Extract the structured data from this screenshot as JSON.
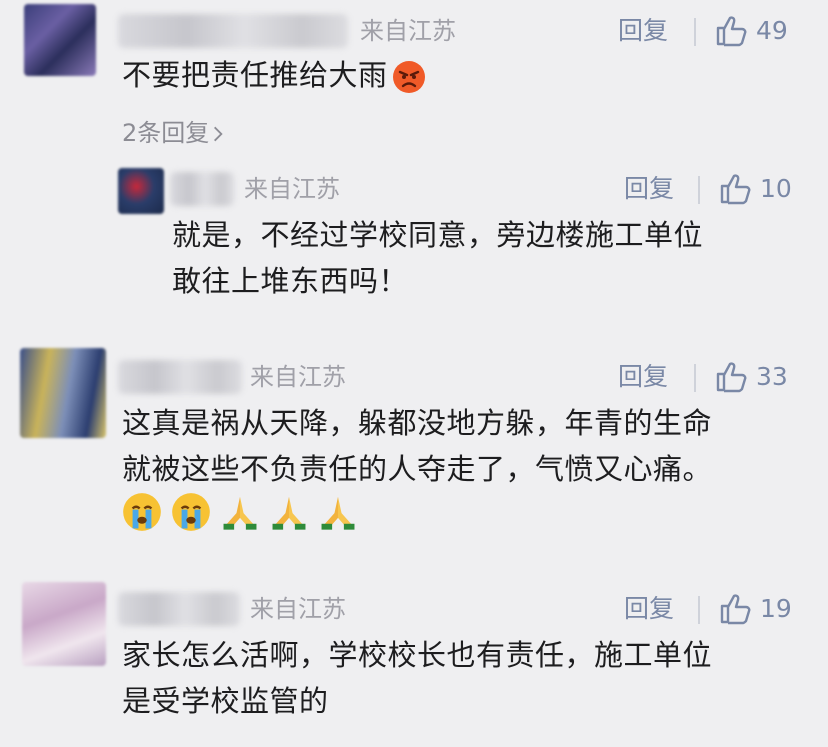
{
  "comments": [
    {
      "location": "来自江苏",
      "reply_label": "回复",
      "likes": "49",
      "text_lines": [
        "不要把责任推给大雨"
      ],
      "emojis": [
        "angry-face"
      ],
      "replies_link": "2条回复",
      "reply": {
        "location": "来自江苏",
        "reply_label": "回复",
        "likes": "10",
        "text_lines": [
          "就是，不经过学校同意，旁边楼施工单位",
          "敢往上堆东西吗！"
        ]
      }
    },
    {
      "location": "来自江苏",
      "reply_label": "回复",
      "likes": "33",
      "text_lines": [
        "这真是祸从天降，躲都没地方躲，年青的生命",
        "就被这些不负责任的人夺走了，气愤又心痛。"
      ],
      "emojis": [
        "crying-face",
        "crying-face",
        "praying-hands",
        "praying-hands",
        "praying-hands"
      ]
    },
    {
      "location": "来自江苏",
      "reply_label": "回复",
      "likes": "19",
      "text_lines": [
        "家长怎么活啊，学校校长也有责任，施工单位",
        "是受学校监管的"
      ]
    }
  ],
  "colors": {
    "background": "#efeff1",
    "link": "#7a88a6",
    "meta": "#a0a0a8",
    "text": "#1d1d1f"
  }
}
